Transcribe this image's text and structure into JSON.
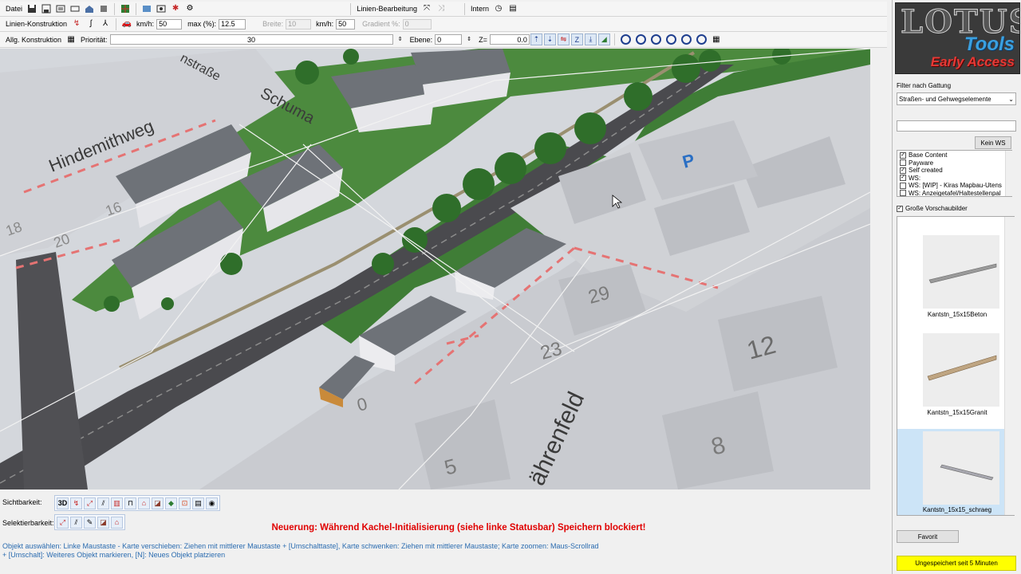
{
  "toolbar1": {
    "menu_datei": "Datei",
    "linien_bearbeitung": "Linien-Bearbeitung",
    "intern": "Intern"
  },
  "toolbar2": {
    "label": "Linien-Konstruktion",
    "kmh_label": "km/h:",
    "kmh_value": "50",
    "max_label": "max (%):",
    "max_value": "12.5",
    "breite_label": "Breite:",
    "breite_value": "10",
    "kmh2_label": "km/h:",
    "kmh2_value": "50",
    "gradient_label": "Gradient %:",
    "gradient_value": "0"
  },
  "toolbar3": {
    "label": "Allg. Konstruktion",
    "prioritaet_label": "Priorität:",
    "prioritaet_value": "30",
    "ebene_label": "Ebene:",
    "ebene_value": "0",
    "z_label": "Z=",
    "z_value": "0.0"
  },
  "map": {
    "street_names": [
      "Hindemithweg",
      "Schuma",
      "nstraße",
      "ährenfeld"
    ],
    "house_numbers": [
      "18",
      "16",
      "20",
      "29",
      "23",
      "12",
      "8",
      "5",
      "0"
    ],
    "parking": "P"
  },
  "bottom": {
    "sichtbarkeit_label": "Sichtbarkeit:",
    "selektierbarkeit_label": "Selektierbarkeit:",
    "view_3d": "3D",
    "warning": "Neuerung: Während Kachel-Initialisierung (siehe linke Statusbar) Speichern blockiert!",
    "help_line1": "Objekt auswählen: Linke Maustaste - Karte verschieben: Ziehen mit mittlerer Maustaste + [Umschalttaste], Karte schwenken: Ziehen mit mittlerer Maustaste; Karte zoomen: Maus-Scrollrad",
    "help_line2": "+ [Umschalt]: Weiteres Objekt markieren, [N]: Neues Objekt platzieren"
  },
  "sidebar": {
    "logo_top": "LOTUS",
    "logo_tools": "Tools",
    "logo_early": "Early Access",
    "filter_label": "Filter nach Gattung",
    "filter_value": "Straßen- und Gehwegselemente",
    "search_value": "",
    "kein_ws_button": "Kein WS",
    "sources": [
      {
        "label": "Base Content",
        "checked": true
      },
      {
        "label": "Payware",
        "checked": false
      },
      {
        "label": "Self created",
        "checked": true
      },
      {
        "label": "WS:",
        "checked": true
      },
      {
        "label": "WS: [WIP] - Kiras Mapbau-Utens",
        "checked": false
      },
      {
        "label": "WS: Anzeigetafel/Haltestellenpal",
        "checked": false
      }
    ],
    "large_previews_label": "Große Vorschaubilder",
    "large_previews_checked": true,
    "items": [
      {
        "label": "Kantstn_15x15Beton"
      },
      {
        "label": "Kantstn_15x15Granit"
      },
      {
        "label": "Kantstn_15x15_schraeg"
      }
    ],
    "favorit_button": "Favorit",
    "status": "Ungespeichert seit 5 Minuten",
    "status_color": "#ffff00"
  }
}
